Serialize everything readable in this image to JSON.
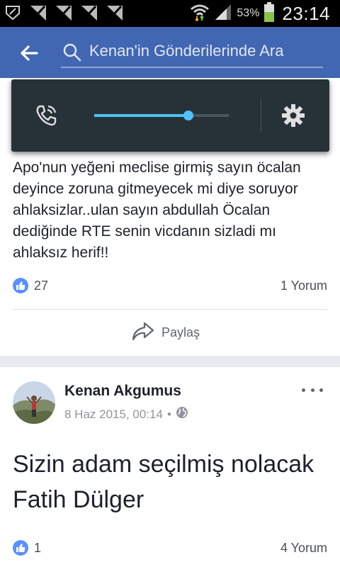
{
  "status_bar": {
    "battery_percent": "53%",
    "time": "23:14",
    "icons": [
      "shield-app-icon",
      "check-notification-icon",
      "check-notification-icon",
      "check-notification-icon",
      "check-notification-icon",
      "wifi-icon",
      "signal-icon",
      "battery-icon"
    ]
  },
  "header": {
    "search_placeholder": "Kenan'in Gönderilerinde Ara",
    "accent_color": "#4267b2"
  },
  "volume_panel": {
    "level": 0.7,
    "accent_color": "#4fc3f7"
  },
  "post1": {
    "text": "Apo'nun yeğeni meclise girmiş sayın öcalan deyince zoruna gitmeyecek mi diye soruyor ahlaksizlar..ulan sayın abdullah Öcalan dediğinde RTE senin vicdanın sizladi mı ahlaksız herif!!",
    "likes": "27",
    "comments": "1 Yorum",
    "share_label": "Paylaş"
  },
  "post2": {
    "author": "Kenan Akgumus",
    "date": "8 Haz 2015, 00:14",
    "date_separator": "•",
    "text_plain": "Sizin adam seçilmiş nolacak",
    "mention": "Fatih Dülger",
    "likes": "1",
    "comments": "4 Yorum"
  }
}
